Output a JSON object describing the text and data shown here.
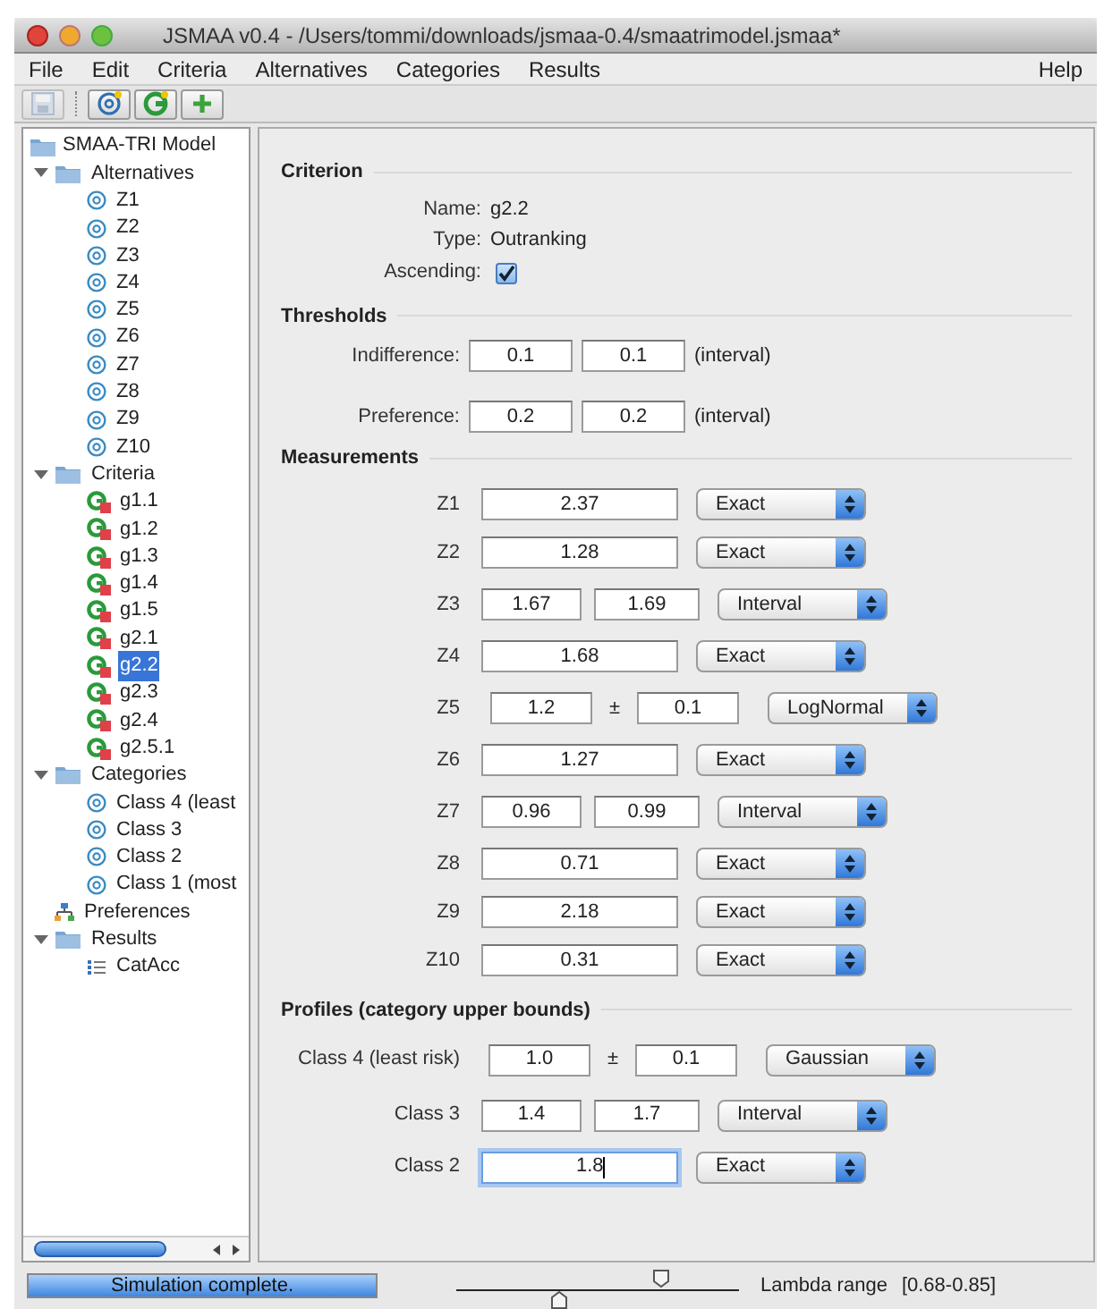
{
  "window": {
    "title": "JSMAA v0.4 - /Users/tommi/downloads/jsmaa-0.4/smaatrimodel.jsmaa*"
  },
  "menu": [
    "File",
    "Edit",
    "Criteria",
    "Alternatives",
    "Categories",
    "Results"
  ],
  "help_menu": "Help",
  "toolbar": [
    {
      "kind": "save",
      "disabled": true
    },
    {
      "kind": "add-alternative",
      "disabled": false
    },
    {
      "kind": "add-criterion",
      "disabled": false
    },
    {
      "kind": "add",
      "disabled": false
    }
  ],
  "tree": {
    "label": "SMAA-TRI Model",
    "kind": "model",
    "children": [
      {
        "label": "Alternatives",
        "kind": "folder",
        "expanded": true,
        "selected": false,
        "children": [
          {
            "label": "Z1",
            "kind": "alternative",
            "selected": false
          },
          {
            "label": "Z2",
            "kind": "alternative",
            "selected": false
          },
          {
            "label": "Z3",
            "kind": "alternative",
            "selected": false
          },
          {
            "label": "Z4",
            "kind": "alternative",
            "selected": false
          },
          {
            "label": "Z5",
            "kind": "alternative",
            "selected": false
          },
          {
            "label": "Z6",
            "kind": "alternative",
            "selected": false
          },
          {
            "label": "Z7",
            "kind": "alternative",
            "selected": false
          },
          {
            "label": "Z8",
            "kind": "alternative",
            "selected": false
          },
          {
            "label": "Z9",
            "kind": "alternative",
            "selected": false
          },
          {
            "label": "Z10",
            "kind": "alternative",
            "selected": false
          }
        ]
      },
      {
        "label": "Criteria",
        "kind": "folder",
        "expanded": true,
        "selected": false,
        "children": [
          {
            "label": "g1.1",
            "kind": "criterion",
            "selected": false
          },
          {
            "label": "g1.2",
            "kind": "criterion",
            "selected": false
          },
          {
            "label": "g1.3",
            "kind": "criterion",
            "selected": false
          },
          {
            "label": "g1.4",
            "kind": "criterion",
            "selected": false
          },
          {
            "label": "g1.5",
            "kind": "criterion",
            "selected": false
          },
          {
            "label": "g2.1",
            "kind": "criterion",
            "selected": false
          },
          {
            "label": "g2.2",
            "kind": "criterion",
            "selected": true
          },
          {
            "label": "g2.3",
            "kind": "criterion",
            "selected": false
          },
          {
            "label": "g2.4",
            "kind": "criterion",
            "selected": false
          },
          {
            "label": "g2.5.1",
            "kind": "criterion",
            "selected": false
          }
        ]
      },
      {
        "label": "Categories",
        "kind": "folder",
        "expanded": true,
        "selected": false,
        "children": [
          {
            "label": "Class 4 (least",
            "kind": "alternative",
            "selected": false
          },
          {
            "label": "Class 3",
            "kind": "alternative",
            "selected": false
          },
          {
            "label": "Class 2",
            "kind": "alternative",
            "selected": false
          },
          {
            "label": "Class 1 (most",
            "kind": "alternative",
            "selected": false
          }
        ]
      },
      {
        "label": "Preferences",
        "kind": "preferences",
        "selected": false
      },
      {
        "label": "Results",
        "kind": "folder",
        "expanded": true,
        "selected": false,
        "children": [
          {
            "label": "CatAcc",
            "kind": "results",
            "selected": false
          }
        ]
      }
    ]
  },
  "criterion": {
    "heading": "Criterion",
    "fields": [
      {
        "label": "Name:",
        "value": "g2.2"
      },
      {
        "label": "Type:",
        "value": "Outranking"
      }
    ],
    "ascending": {
      "label": "Ascending:",
      "checked": true
    }
  },
  "thresholds": {
    "heading": "Thresholds",
    "rows": [
      {
        "label": "Indifference:",
        "low": "0.1",
        "high": "0.1",
        "note": "(interval)"
      },
      {
        "label": "Preference:",
        "low": "0.2",
        "high": "0.2",
        "note": "(interval)"
      }
    ]
  },
  "measurements": {
    "heading": "Measurements",
    "rows": [
      {
        "label": "Z1",
        "kind": "exact",
        "values": [
          "2.37"
        ],
        "distribution": "Exact"
      },
      {
        "label": "Z2",
        "kind": "exact",
        "values": [
          "1.28"
        ],
        "distribution": "Exact"
      },
      {
        "label": "Z3",
        "kind": "interval",
        "values": [
          "1.67",
          "1.69"
        ],
        "distribution": "Interval"
      },
      {
        "label": "Z4",
        "kind": "exact",
        "values": [
          "1.68"
        ],
        "distribution": "Exact"
      },
      {
        "label": "Z5",
        "kind": "plusminus",
        "values": [
          "1.2",
          "0.1"
        ],
        "separator": "±",
        "distribution": "LogNormal"
      },
      {
        "label": "Z6",
        "kind": "exact",
        "values": [
          "1.27"
        ],
        "distribution": "Exact"
      },
      {
        "label": "Z7",
        "kind": "interval",
        "values": [
          "0.96",
          "0.99"
        ],
        "distribution": "Interval"
      },
      {
        "label": "Z8",
        "kind": "exact",
        "values": [
          "0.71"
        ],
        "distribution": "Exact"
      },
      {
        "label": "Z9",
        "kind": "exact",
        "values": [
          "2.18"
        ],
        "distribution": "Exact"
      },
      {
        "label": "Z10",
        "kind": "exact",
        "values": [
          "0.31"
        ],
        "distribution": "Exact"
      }
    ]
  },
  "profiles": {
    "heading": "Profiles (category upper bounds)",
    "rows": [
      {
        "label": "Class 4 (least risk)",
        "kind": "plusminus",
        "values": [
          "1.0",
          "0.1"
        ],
        "separator": "±",
        "distribution": "Gaussian"
      },
      {
        "label": "Class 3",
        "kind": "interval",
        "values": [
          "1.4",
          "1.7"
        ],
        "distribution": "Interval"
      },
      {
        "label": "Class 2",
        "kind": "exact",
        "values": [
          "1.8"
        ],
        "distribution": "Exact",
        "focused": true
      }
    ]
  },
  "status_bar": {
    "progress": {
      "text": "Simulation complete.",
      "level": 1
    },
    "lambda_slider": {
      "thumbs": [
        {
          "level": 0.36
        },
        {
          "level": 0.72
        }
      ]
    },
    "lambda_label": "Lambda range",
    "lambda_value": "[0.68-0.85]"
  }
}
